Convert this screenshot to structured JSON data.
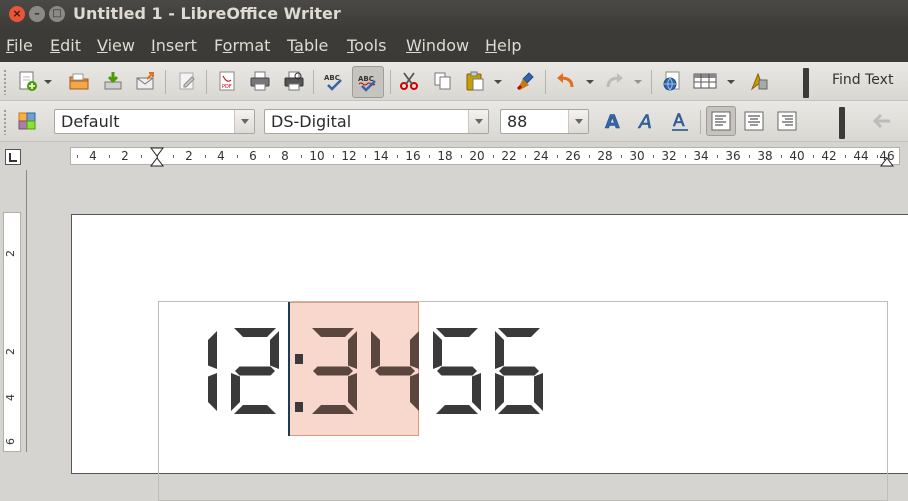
{
  "window": {
    "title": "Untitled 1 - LibreOffice Writer",
    "controls": {
      "close": "×",
      "minimize": "–",
      "maximize": "□"
    }
  },
  "menubar": [
    {
      "accel": "F",
      "rest": "ile"
    },
    {
      "accel": "E",
      "rest": "dit"
    },
    {
      "accel": "V",
      "rest": "iew"
    },
    {
      "accel": "I",
      "rest": "nsert"
    },
    {
      "pre": "F",
      "accel": "o",
      "rest": "rmat"
    },
    {
      "pre": "T",
      "accel": "a",
      "rest": "ble"
    },
    {
      "accel": "T",
      "rest": "ools"
    },
    {
      "accel": "W",
      "rest": "indow"
    },
    {
      "accel": "H",
      "rest": "elp"
    }
  ],
  "toolbar": {
    "find_text": "Find Text"
  },
  "format": {
    "paragraph_style": "Default",
    "font_name": "DS-Digital",
    "font_size": "88"
  },
  "ruler": {
    "labels": [
      "4",
      "2",
      "2",
      "4",
      "6",
      "8",
      "10",
      "12",
      "14",
      "16",
      "18",
      "20",
      "22",
      "24",
      "26",
      "28",
      "30",
      "32",
      "34",
      "36",
      "38",
      "40",
      "42",
      "44",
      "46"
    ]
  },
  "vruler": {
    "labels": [
      "2",
      "2",
      "4",
      "6"
    ]
  },
  "document": {
    "text": "12:3456",
    "selected_text": "34"
  },
  "colors": {
    "selection": "#f8d8cc",
    "digit": "#3a3a3a",
    "digit_selected": "#5b463e",
    "titlebar": "#3c3b37",
    "close_button": "#e8553b"
  }
}
